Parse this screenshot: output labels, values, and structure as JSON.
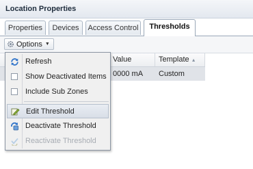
{
  "panel": {
    "title": "Location Properties"
  },
  "tabs": [
    {
      "label": "Properties"
    },
    {
      "label": "Devices"
    },
    {
      "label": "Access Control"
    },
    {
      "label": "Thresholds",
      "active": true
    }
  ],
  "toolbar": {
    "options_label": "Options"
  },
  "grid": {
    "columns": [
      {
        "label": "Value"
      },
      {
        "label": "Template",
        "sorted": "ascending"
      }
    ],
    "rows": [
      {
        "value": "0000 mA",
        "template": "Custom"
      }
    ]
  },
  "menu": {
    "items": [
      {
        "label": "Refresh",
        "icon": "refresh-icon"
      },
      {
        "label": "Show Deactivated Items",
        "checkbox": true,
        "checked": false
      },
      {
        "label": "Include Sub Zones",
        "checkbox": true,
        "checked": false
      },
      {
        "label": "Edit Threshold",
        "icon": "edit-icon",
        "highlighted": true
      },
      {
        "label": "Deactivate Threshold",
        "icon": "deactivate-icon"
      },
      {
        "label": "Reactivate Threshold",
        "icon": "reactivate-icon",
        "disabled": true
      }
    ]
  },
  "colors": {
    "accent": "#3a7bd5",
    "header_bg": "#e3e8ef",
    "selected_row": "#e0e3e8"
  }
}
